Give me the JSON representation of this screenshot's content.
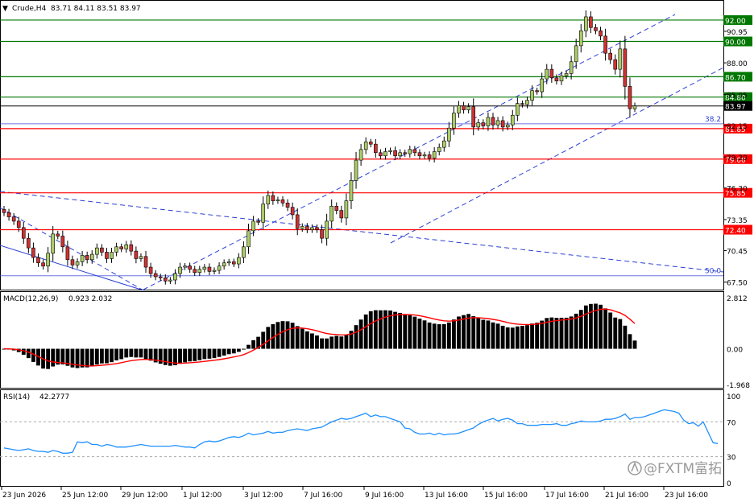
{
  "header": {
    "symbol_label": "Crude,H4",
    "ohlc_text": "83.71 84.11 83.51 83.97",
    "menu_icon": "triangle-down-icon"
  },
  "watermark": {
    "text": "@FXTM富拓",
    "icon": "fxtm-logo-icon"
  },
  "colors": {
    "bull": "#aacc66",
    "bear": "#cc3333",
    "macd_hist": "#000000",
    "signal": "#ff0000",
    "rsi": "#1e90ff",
    "channel": "#2b3fd6",
    "support": "#ff0000",
    "resistance": "#007700",
    "current": "#000000",
    "fib": "#2b3fd6"
  },
  "chart_data": [
    {
      "type": "candlestick",
      "title": "Crude,H4",
      "price_axis_ticks": [
        67.5,
        70.45,
        73.35,
        76.3,
        79.2,
        82.15,
        85.05,
        88.0,
        90.95
      ],
      "x_tick_labels": [
        "23 Jun 2026",
        "25 Jun 12:00",
        "29 Jun 12:00",
        "1 Jul 12:00",
        "3 Jul 12:00",
        "7 Jul 16:00",
        "9 Jul 16:00",
        "13 Jul 16:00",
        "15 Jul 16:00",
        "17 Jul 16:00",
        "21 Jul 16:00",
        "23 Jul 16:00"
      ],
      "ylim": [
        66.8,
        93.8
      ],
      "resistance_levels": [
        {
          "label": "92.00",
          "value": 92.0
        },
        {
          "label": "90.00",
          "value": 90.0
        },
        {
          "label": "86.70",
          "value": 86.7
        },
        {
          "label": "84.80",
          "value": 84.8
        }
      ],
      "support_levels": [
        {
          "label": "81.85",
          "value": 81.85
        },
        {
          "label": "79.00",
          "value": 79.0
        },
        {
          "label": "75.85",
          "value": 75.85
        },
        {
          "label": "72.40",
          "value": 72.4
        }
      ],
      "current_price": {
        "label": "83.97",
        "value": 83.97
      },
      "fib_levels": [
        {
          "label": "38.2",
          "value": 82.3
        },
        {
          "label": "50.0",
          "value": 68.1
        }
      ],
      "closes": [
        74.0,
        73.6,
        73.2,
        72.6,
        71.6,
        70.7,
        69.8,
        69.3,
        69.0,
        70.2,
        72.0,
        71.8,
        70.8,
        69.6,
        69.1,
        69.4,
        70.0,
        69.6,
        70.1,
        70.7,
        70.3,
        69.7,
        70.3,
        70.8,
        70.6,
        71.0,
        70.4,
        69.7,
        69.9,
        68.9,
        68.3,
        68.0,
        67.9,
        67.6,
        67.7,
        68.3,
        68.9,
        69.0,
        68.7,
        68.4,
        68.7,
        68.9,
        68.5,
        68.6,
        69.0,
        69.3,
        69.4,
        69.2,
        69.8,
        70.8,
        72.3,
        73.2,
        73.1,
        74.8,
        75.6,
        75.1,
        75.2,
        74.9,
        74.5,
        73.8,
        72.5,
        72.7,
        72.4,
        72.6,
        72.4,
        71.6,
        73.2,
        74.6,
        74.2,
        73.5,
        75.1,
        77.0,
        78.9,
        79.9,
        80.6,
        80.4,
        79.6,
        79.3,
        79.7,
        79.8,
        79.3,
        79.6,
        79.5,
        79.9,
        79.6,
        79.3,
        79.4,
        79.1,
        79.7,
        80.1,
        80.7,
        81.9,
        83.3,
        84.0,
        83.6,
        83.9,
        82.0,
        82.4,
        82.1,
        82.9,
        82.2,
        82.6,
        82.0,
        82.2,
        83.1,
        84.2,
        84.1,
        84.5,
        85.4,
        85.3,
        86.5,
        87.4,
        86.6,
        86.3,
        86.8,
        87.0,
        88.1,
        89.6,
        91.0,
        92.3,
        91.3,
        91.0,
        90.5,
        88.9,
        88.3,
        87.4,
        89.3,
        85.8,
        83.71,
        83.97
      ],
      "series": [
        {
          "name": "MACD(12,26,9)",
          "label_values": "0.923 2.032",
          "axis_ticks": [
            2.812,
            0.0,
            -1.968
          ]
        },
        {
          "name": "RSI(14)",
          "label_value": "42.2777",
          "axis_ticks": [
            100,
            70,
            30,
            0
          ],
          "values": [
            40,
            39,
            38,
            37,
            38,
            39,
            37,
            36,
            36,
            35,
            37,
            36,
            34,
            34,
            35,
            47,
            46,
            47,
            44,
            44,
            42,
            44,
            43,
            41,
            41,
            41,
            42,
            43,
            44,
            43,
            42,
            42,
            42,
            42,
            42,
            43,
            42,
            41,
            41,
            40,
            44,
            47,
            48,
            47,
            48,
            50,
            52,
            53,
            52,
            54,
            57,
            55,
            56,
            57,
            59,
            57,
            58,
            58,
            60,
            61,
            62,
            61,
            60,
            62,
            63,
            64,
            67,
            70,
            72,
            74,
            73,
            74,
            76,
            78,
            80,
            76,
            78,
            76,
            76,
            74,
            72,
            70,
            63,
            62,
            58,
            56,
            56,
            57,
            55,
            57,
            55,
            56,
            56,
            57,
            59,
            61,
            63,
            67,
            70,
            72,
            74,
            71,
            73,
            74,
            72,
            68,
            68,
            66,
            66,
            66,
            67,
            67,
            67,
            68,
            66,
            66,
            68,
            69,
            71,
            70,
            70,
            70,
            71,
            73,
            73,
            74,
            76,
            79,
            73,
            75,
            75,
            76,
            78,
            80,
            82,
            84,
            83,
            82,
            80,
            72,
            68,
            69,
            65,
            70,
            58,
            46,
            45
          ]
        }
      ]
    }
  ]
}
